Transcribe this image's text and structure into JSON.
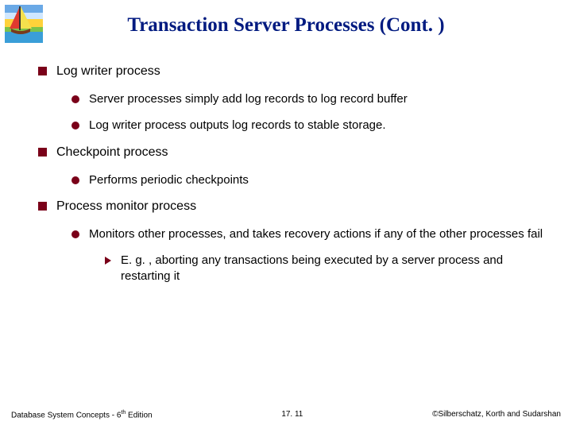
{
  "title": "Transaction Server Processes (Cont. )",
  "bullets": {
    "b1": "Log writer process",
    "b1a": "Server processes simply add log records to log record buffer",
    "b1b": "Log writer process outputs log records to stable storage.",
    "b2": "Checkpoint process",
    "b2a": "Performs periodic checkpoints",
    "b3": "Process monitor process",
    "b3a": "Monitors other processes, and takes recovery actions if any of the other processes fail",
    "b3a1": "E. g. , aborting any transactions being executed by a server process and restarting it"
  },
  "footer": {
    "left_prefix": "Database System Concepts - 6",
    "left_sup": "th",
    "left_suffix": " Edition",
    "center": "17. 11",
    "right": "©Silberschatz, Korth and Sudarshan"
  }
}
